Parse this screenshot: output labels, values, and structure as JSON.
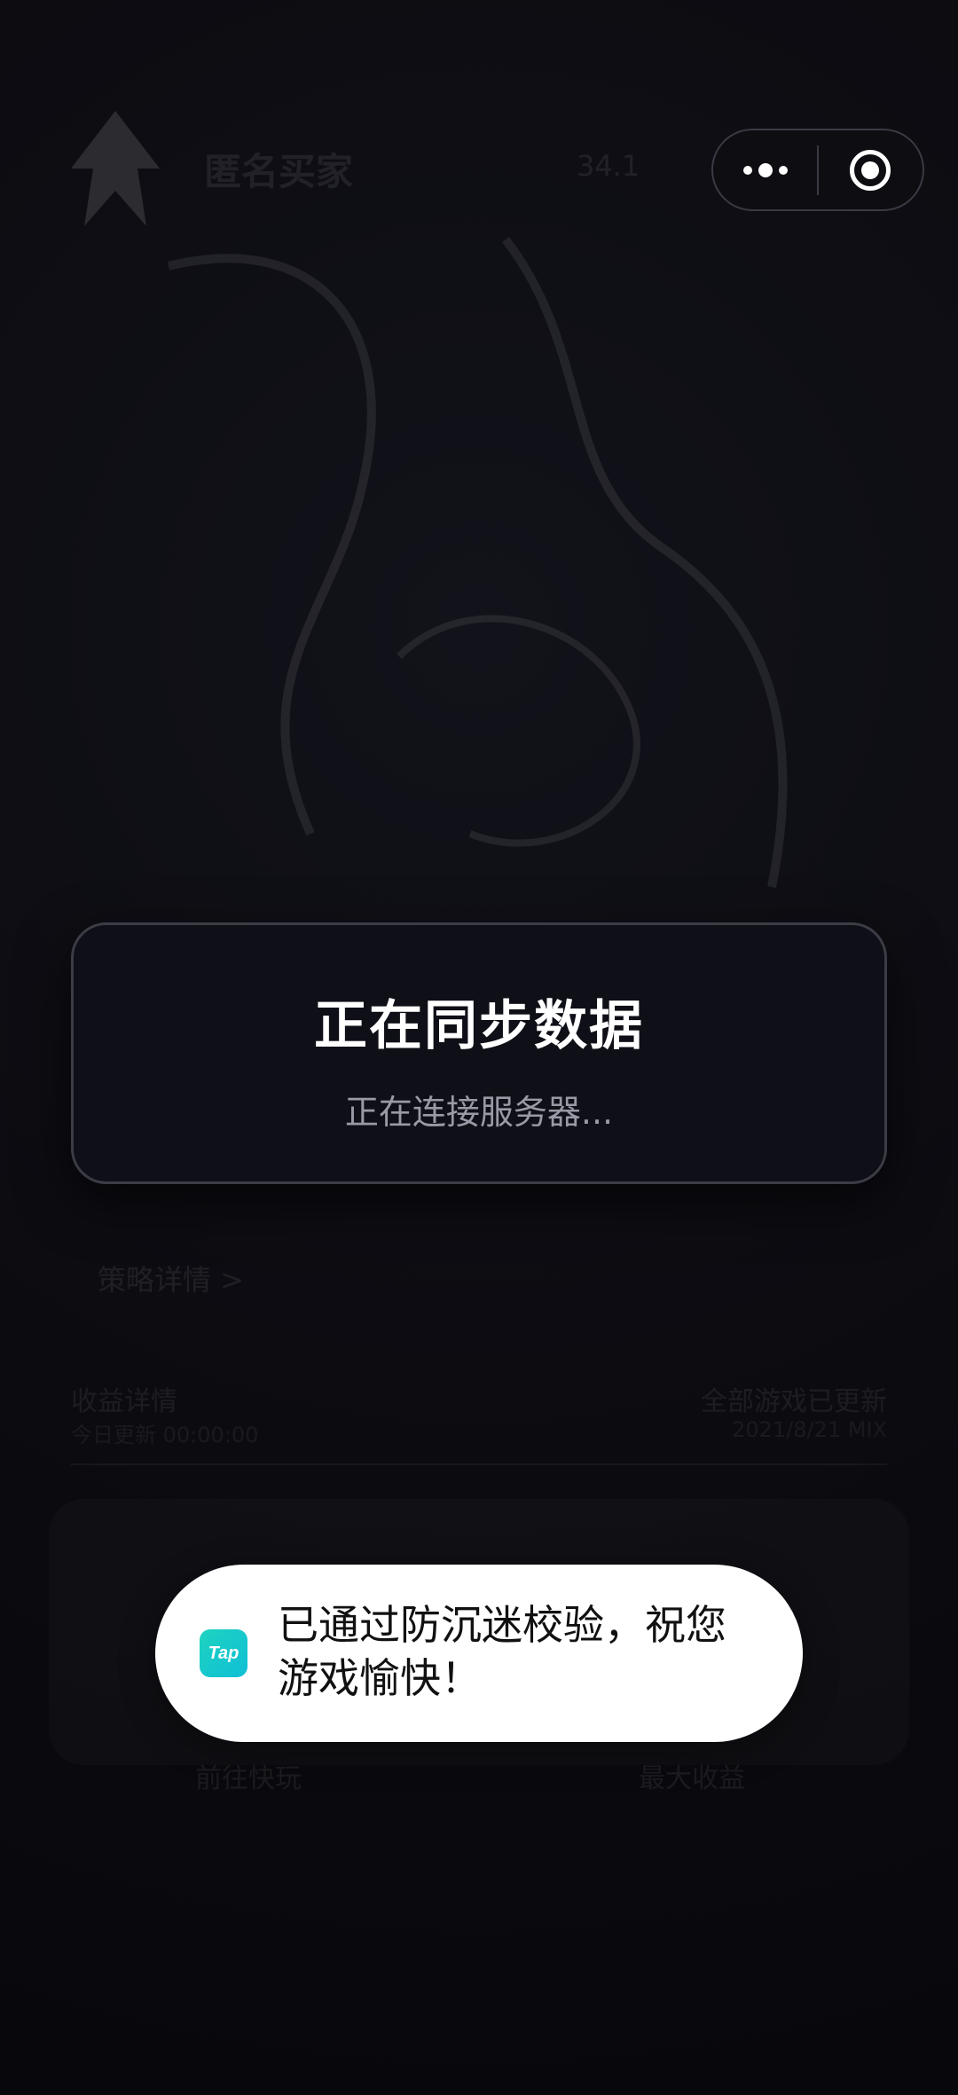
{
  "background": {
    "title": "匿名买家",
    "coins": "34.1",
    "link": "策略详情  >",
    "row_left_title": "收益详情",
    "row_left_sub": "今日更新 00:00:00",
    "row_right_title": "全部游戏已更新",
    "row_right_sub": "2021/8/21 MIX",
    "card_left": "前往快玩",
    "card_right": "最大收益"
  },
  "capsule": {
    "more_icon": "more-dots-icon",
    "close_icon": "target-close-icon"
  },
  "sync_dialog": {
    "title": "正在同步数据",
    "subtitle": "正在连接服务器..."
  },
  "toast": {
    "icon_label": "Tap",
    "message": "已通过防沉迷校验，祝您游戏愉快！"
  },
  "colors": {
    "background": "#0b0b10",
    "dialog_bg": "#0f0f17",
    "toast_bg": "#ffffff",
    "tap_brand": "#1fd3c0"
  }
}
